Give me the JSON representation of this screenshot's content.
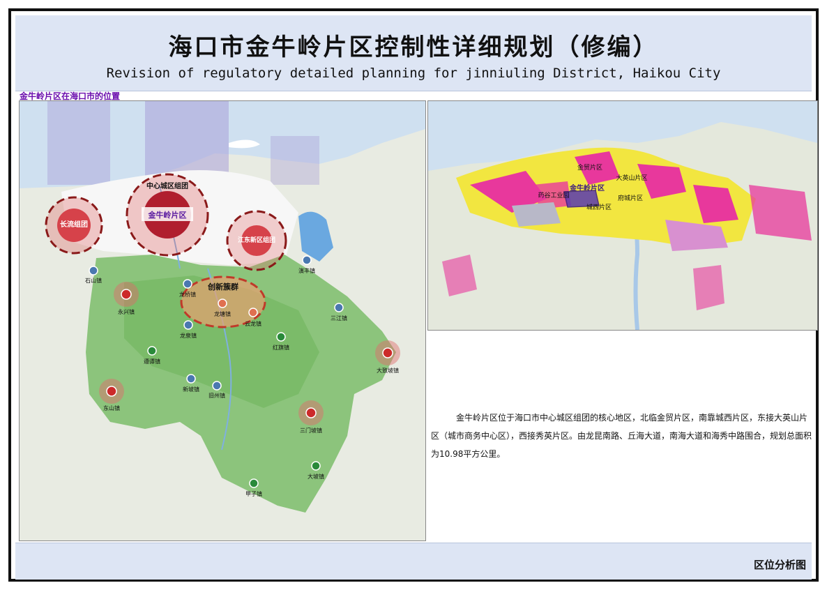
{
  "header": {
    "title_cn": "海口市金牛岭片区控制性详细规划（修编）",
    "title_en": "Revision of regulatory detailed planning for jinniuling District, Haikou City"
  },
  "section": {
    "label": "金牛岭片区在海口市的位置"
  },
  "left_map": {
    "clusters": {
      "center": "中心城区组团",
      "jinniuling": "金牛岭片区",
      "changliu": "长流组团",
      "jiangdong": "江东新区组团",
      "innovation": "创新簇群"
    },
    "towns": {
      "shishan": "石山镇",
      "yongxing": "永兴镇",
      "longqiao": "龙桥镇",
      "longtang": "龙塘镇",
      "longquan": "龙泉镇",
      "yunlong": "云龙镇",
      "yanfeng": "演丰镇",
      "sanjiang": "三江镇",
      "hongqi": "红旗镇",
      "dazhipo": "大致坡镇",
      "zuntan": "遵谭镇",
      "xinpo": "新坡镇",
      "jiuzhou": "旧州镇",
      "dongshan": "东山镇",
      "sanmenpo": "三门坡镇",
      "jiazi": "甲子镇",
      "dapo": "大坡镇"
    }
  },
  "right_map": {
    "labels": {
      "jinmao": "金贸片区",
      "dayingshan": "大英山片区",
      "yaogu": "药谷工业园",
      "jinniuling": "金牛岭片区",
      "fucheng": "府城片区",
      "chengxi": "城西片区"
    }
  },
  "description": "金牛岭片区位于海口市中心城区组团的核心地区，北临金贸片区，南靠城西片区，东接大英山片区（城市商务中心区），西接秀英片区。由龙昆南路、丘海大道，南海大道和海秀中路围合，规划总面积为10.98平方公里。",
  "footer": {
    "label": "区位分析图"
  },
  "colors": {
    "title_bar": "#dde5f4",
    "section_label": "#6a0dad",
    "sea": "#cfe0f0",
    "district_green": "#8cc47c",
    "red_node": "#cc2a2a",
    "blue_node": "#4a78b0",
    "green_node": "#2a8a3a",
    "residential_yellow": "#f2e640",
    "commercial_magenta": "#e8389c"
  }
}
